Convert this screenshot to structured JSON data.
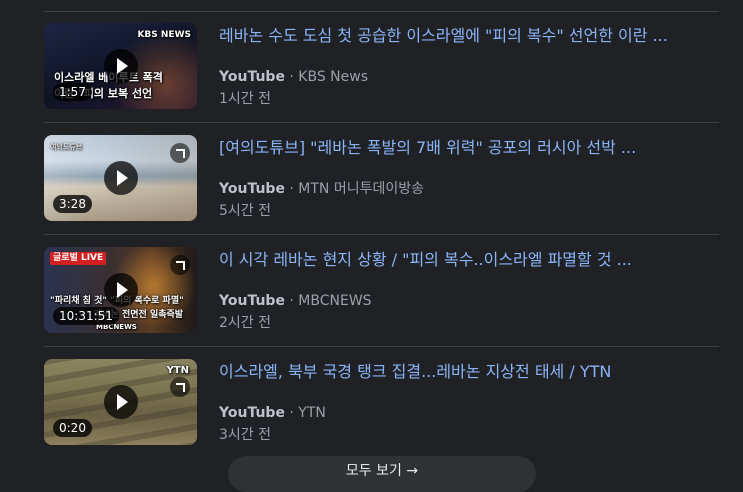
{
  "videos": [
    {
      "title": "레바논 수도 도심 첫 공습한 이스라엘에 \"피의 복수\" 선언한 이란 ...",
      "platform": "YouTube",
      "channel": "KBS News",
      "time": "1시간 전",
      "duration": "1:57",
      "thumb_logo": "KBS NEWS",
      "thumb_caption_1": "이스라엘 베이루트 폭격",
      "thumb_caption_2": "이란 \"피의 보복 선언"
    },
    {
      "title": "[여의도튜브] \"레바논 폭발의 7배 위력\" 공포의 러시아 선박 ...",
      "platform": "YouTube",
      "channel": "MTN 머니투데이방송",
      "time": "5시간 전",
      "duration": "3:28",
      "thumb_tag": "여의도튜브"
    },
    {
      "title": "이 시각 레바논 현지 상황 / \"피의 복수..이스라엘 파멸할 것 ...",
      "platform": "YouTube",
      "channel": "MBCNEWS",
      "time": "2시간 전",
      "duration": "10:31:51",
      "thumb_live": "글로벌 LIVE",
      "thumb_caption_1": "\"파리채 침 것\" \"피의 복수로 파멸\"",
      "thumb_caption_2": "레바논 전면전 일촉즉발",
      "thumb_logo": "MBCNEWS"
    },
    {
      "title": "이스라엘, 북부 국경 탱크 집결...레바논 지상전 태세 / YTN",
      "platform": "YouTube",
      "channel": "YTN",
      "time": "3시간 전",
      "duration": "0:20",
      "thumb_logo": "YTN"
    }
  ],
  "show_all_label": "모두 보기 →",
  "separator": "·"
}
